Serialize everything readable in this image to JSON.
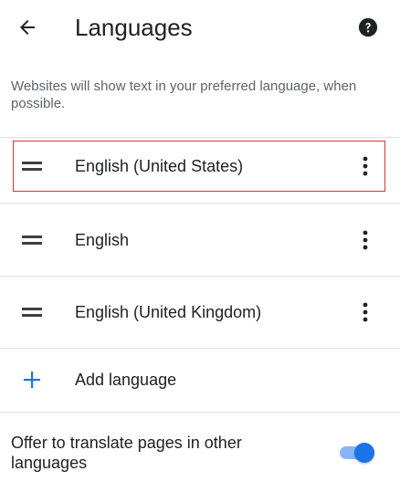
{
  "app_bar": {
    "title": "Languages",
    "back_icon": "arrow-left-icon",
    "help_icon": "help-circle-icon"
  },
  "description": "Websites will show text in your preferred language, when possible.",
  "languages": [
    {
      "label": "English (United States)",
      "selected": true
    },
    {
      "label": "English",
      "selected": false
    },
    {
      "label": "English (United Kingdom)",
      "selected": false
    }
  ],
  "add_language": {
    "label": "Add language",
    "icon": "plus-icon"
  },
  "translate": {
    "label": "Offer to translate pages in other languages",
    "enabled": true
  },
  "colors": {
    "accent": "#1a73e8",
    "accent_track": "#8ab4f8",
    "highlight_border": "#e0313a",
    "text_primary": "#202124",
    "text_secondary": "#5f6368",
    "divider": "#e0e0e0"
  }
}
